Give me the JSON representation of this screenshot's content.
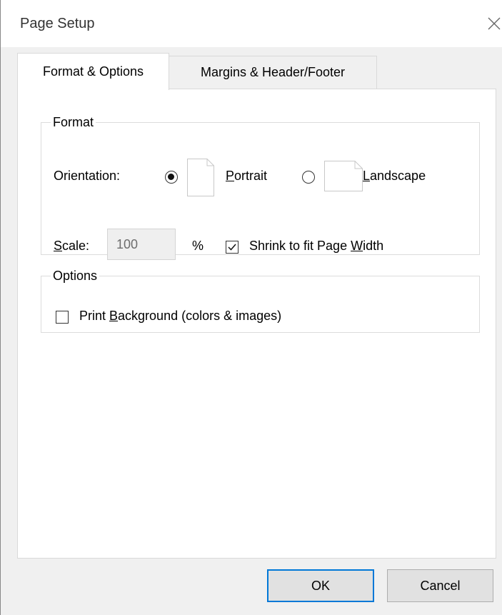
{
  "window": {
    "title": "Page Setup"
  },
  "tabs": [
    {
      "label": "Format & Options",
      "active": true
    },
    {
      "label": "Margins & Header/Footer",
      "active": false
    }
  ],
  "format": {
    "legend": "Format",
    "orientation_label": "Orientation:",
    "portrait": {
      "prefix": "",
      "accel": "P",
      "rest": "ortrait",
      "selected": true
    },
    "landscape": {
      "prefix": "",
      "accel": "L",
      "rest": "andscape",
      "selected": false
    },
    "scale": {
      "accel": "S",
      "rest": "cale:",
      "value": "100",
      "unit": "%"
    },
    "shrink": {
      "prefix": "Shrink to fit Page ",
      "accel": "W",
      "rest": "idth",
      "checked": true
    }
  },
  "options": {
    "legend": "Options",
    "print_background": {
      "prefix": "Print ",
      "accel": "B",
      "rest": "ackground (colors & images)",
      "checked": false
    }
  },
  "buttons": {
    "ok": "OK",
    "cancel": "Cancel"
  },
  "colors": {
    "default_button_border": "#0078d7",
    "panel_bg": "#ffffff",
    "window_bg": "#f0f0f0"
  }
}
